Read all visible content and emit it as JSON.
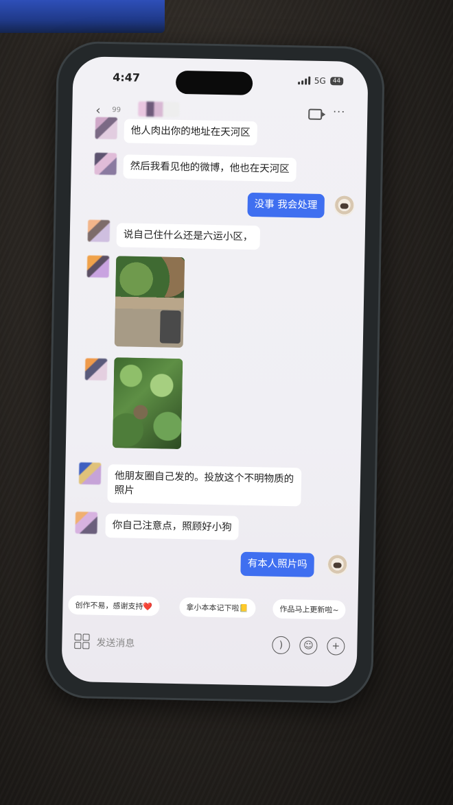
{
  "status_bar": {
    "time": "4:47",
    "network": "5G",
    "battery": "44"
  },
  "chat_header": {
    "back_count": "99"
  },
  "messages": {
    "m1": "他人肉出你的地址在天河区",
    "m2": "然后我看见他的微博，他也在天河区",
    "m3": "没事 我会处理",
    "m4": "说自己住什么还是六运小区，",
    "m5": "他朋友圈自己发的。投放这个不明物质的照片",
    "m6": "你自己注意点，照顾好小狗",
    "m7": "有本人照片吗"
  },
  "quick_replies": [
    "创作不易，感谢支持❤️",
    "拿小本本记下啦📒",
    "作品马上更新啦~"
  ],
  "input": {
    "placeholder": "发送消息"
  },
  "icons": {
    "back": "chevron-left-icon",
    "video": "video-call-icon",
    "more": "more-icon",
    "apps": "apps-grid-icon",
    "voice": "voice-icon",
    "emoji": "emoji-icon",
    "add": "add-icon"
  },
  "colors": {
    "outgoing_bubble": "#3f6ff0",
    "incoming_bubble": "#ffffff",
    "screen_bg": "#f2f1f5"
  }
}
